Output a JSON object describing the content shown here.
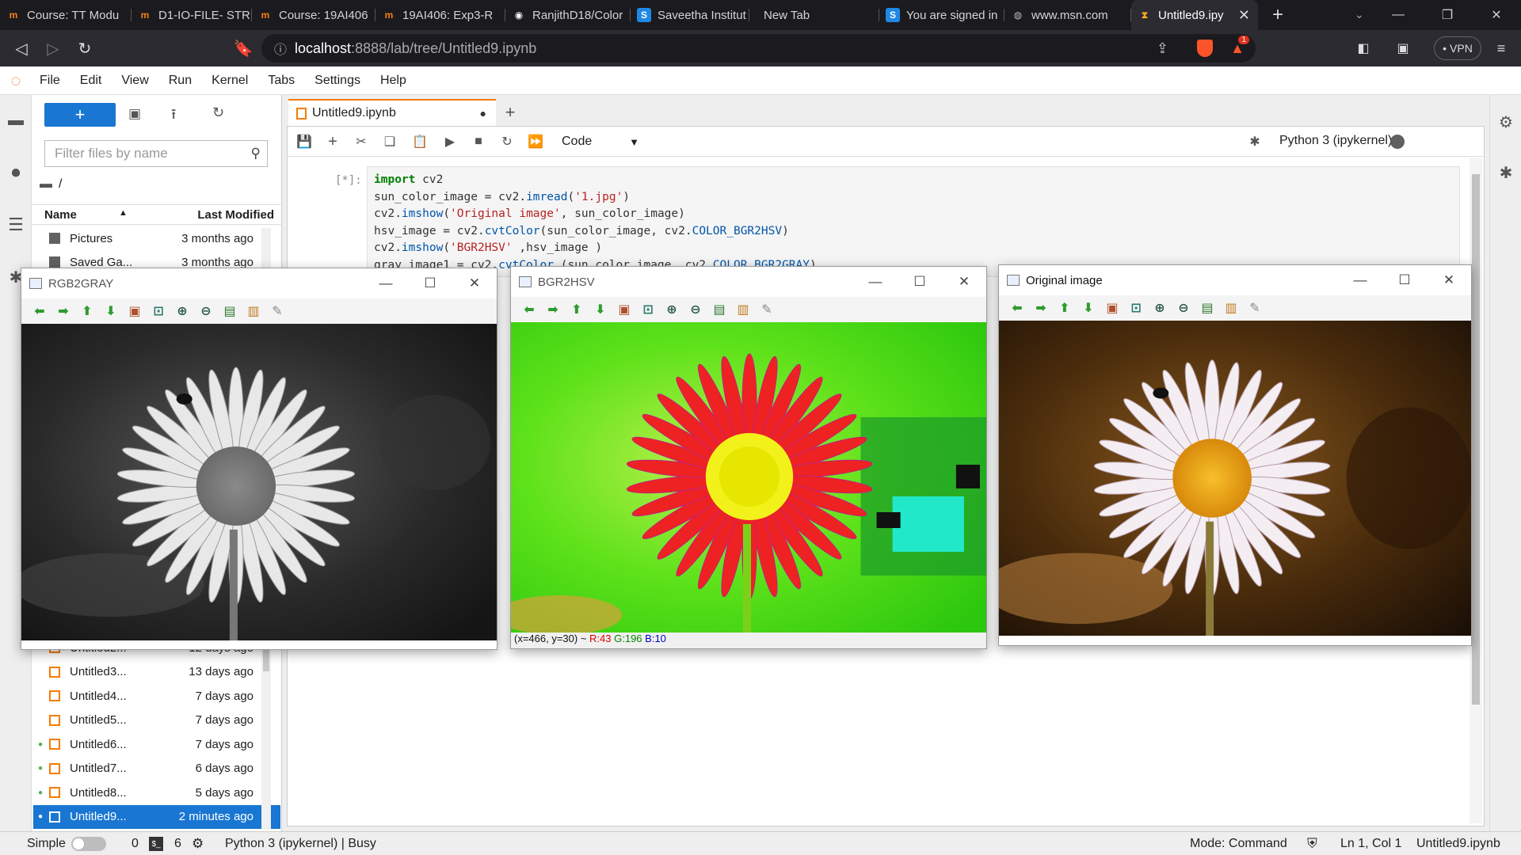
{
  "browser": {
    "tabs": [
      {
        "label": "Course: TT Modu",
        "icon": "moodle-icon"
      },
      {
        "label": "D1-IO-FILE- STRE",
        "icon": "moodle-icon"
      },
      {
        "label": "Course: 19AI406",
        "icon": "moodle-icon"
      },
      {
        "label": "19AI406: Exp3-R",
        "icon": "moodle-icon"
      },
      {
        "label": "RanjithD18/Color",
        "icon": "github-icon"
      },
      {
        "label": "Saveetha Institut",
        "icon": "s-icon"
      },
      {
        "label": "New Tab",
        "icon": ""
      },
      {
        "label": "You are signed in",
        "icon": "s-icon"
      },
      {
        "label": "www.msn.com",
        "icon": "globe-icon"
      },
      {
        "label": "Untitled9.ipy",
        "icon": "hourglass-icon",
        "active": true
      }
    ],
    "url_host": "localhost",
    "url_path": ":8888/lab/tree/Untitled9.ipynb",
    "vpn_label": "VPN",
    "shield_badge": "1"
  },
  "menu": [
    "File",
    "Edit",
    "View",
    "Run",
    "Kernel",
    "Tabs",
    "Settings",
    "Help"
  ],
  "filebrowser": {
    "new_label": "+",
    "filter_placeholder": "Filter files by name",
    "path": "/",
    "col_name": "Name",
    "col_modified": "Last Modified",
    "files_top": [
      {
        "name": "Pictures",
        "modified": "3 months ago",
        "type": "folder"
      },
      {
        "name": "Saved Ga...",
        "modified": "3 months ago",
        "type": "folder"
      }
    ],
    "files_bottom": [
      {
        "name": "Untitled2...",
        "modified": "12 days ago",
        "running": false
      },
      {
        "name": "Untitled3...",
        "modified": "13 days ago",
        "running": false
      },
      {
        "name": "Untitled4...",
        "modified": "7 days ago",
        "running": false
      },
      {
        "name": "Untitled5...",
        "modified": "7 days ago",
        "running": false
      },
      {
        "name": "Untitled6...",
        "modified": "7 days ago",
        "running": true
      },
      {
        "name": "Untitled7...",
        "modified": "6 days ago",
        "running": true
      },
      {
        "name": "Untitled8...",
        "modified": "5 days ago",
        "running": true
      },
      {
        "name": "Untitled9...",
        "modified": "2 minutes ago",
        "running": true,
        "selected": true
      }
    ]
  },
  "notebook": {
    "tab_label": "Untitled9.ipynb",
    "cell_type": "Code",
    "kernel": "Python 3 (ipykernel)",
    "prompt": "[*]:",
    "code_lines": [
      "import cv2",
      "sun_color_image = cv2.imread('1.jpg')",
      "cv2.imshow('Original image', sun_color_image)",
      "hsv_image = cv2.cvtColor(sun_color_image, cv2.COLOR_BGR2HSV)",
      "cv2.imshow('BGR2HSV' ,hsv_image )",
      "gray_image1 = cv2.cvtColor (sun_color_image, cv2.COLOR_BGR2GRAY)"
    ]
  },
  "cv_windows": {
    "gray": {
      "title": "RGB2GRAY"
    },
    "hsv": {
      "title": "BGR2HSV",
      "status_pos": "(x=466, y=30) ~ ",
      "r": "R:43",
      "g": "G:196",
      "b": "B:10"
    },
    "orig": {
      "title": "Original image"
    }
  },
  "statusbar": {
    "mode_label": "Simple",
    "terminals": "0",
    "kernels": "6",
    "kernel_status": "Python 3 (ipykernel) | Busy",
    "mode": "Mode: Command",
    "cursor": "Ln 1, Col 1",
    "file": "Untitled9.ipynb"
  }
}
